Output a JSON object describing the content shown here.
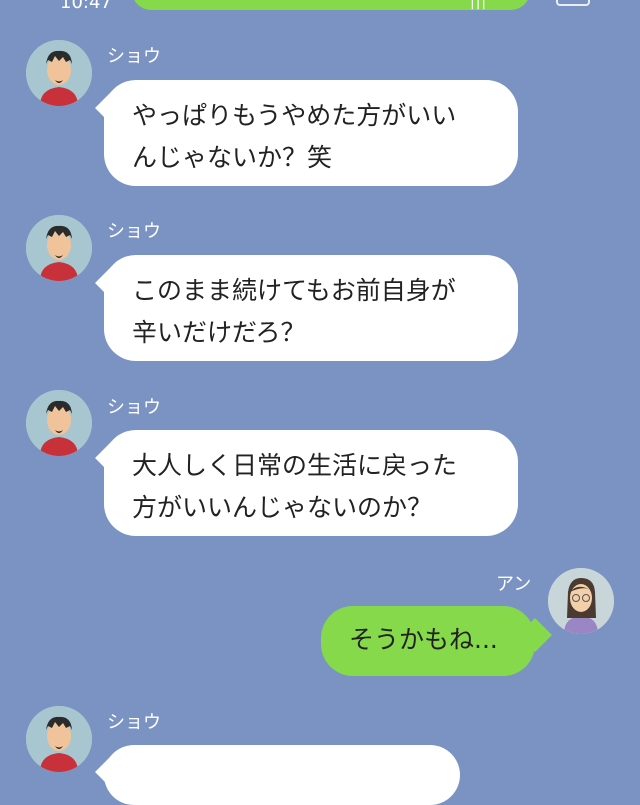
{
  "status_bar": {
    "time": "10:47",
    "signal": "|||"
  },
  "messages": [
    {
      "sender": "ショウ",
      "text": "やっぱりもうやめた方がいい\nんじゃないか？笑"
    },
    {
      "sender": "ショウ",
      "text": "このまま続けてもお前自身が\n辛いだけだろ？"
    },
    {
      "sender": "ショウ",
      "text": "大人しく日常の生活に戻った\n方がいいんじゃないのか？"
    },
    {
      "sender": "アン",
      "text": "そうかもね..."
    },
    {
      "sender": "ショウ",
      "text": ""
    }
  ],
  "colors": {
    "background": "#7b93c2",
    "own_bubble": "#86d94a",
    "other_bubble": "#ffffff"
  },
  "icons": [
    "man-avatar-icon",
    "woman-avatar-icon",
    "battery-icon"
  ]
}
